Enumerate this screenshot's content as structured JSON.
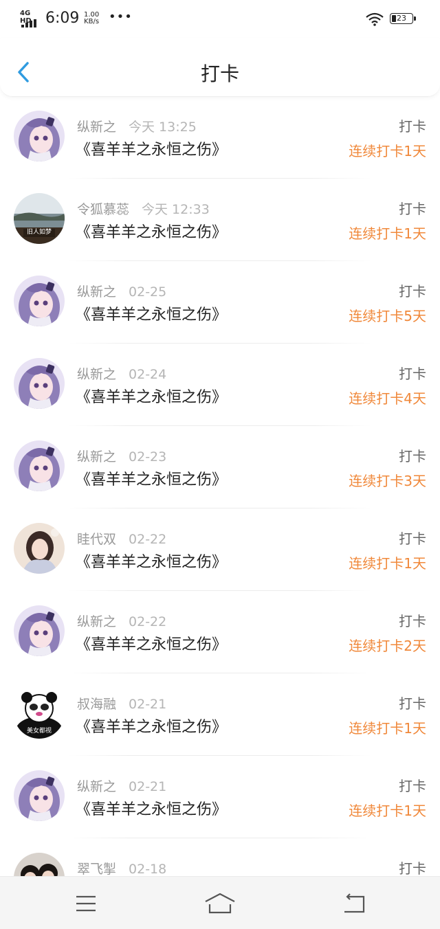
{
  "status_bar": {
    "network": "4G HD",
    "time": "6:09",
    "speed_value": "1.00",
    "speed_unit": "KB/s",
    "more": "•••",
    "battery": "23"
  },
  "header": {
    "title": "打卡"
  },
  "rows": [
    {
      "name": "纵新之",
      "date": "今天 13:25",
      "content": "《喜羊羊之永恒之伤》",
      "action": "打卡",
      "streak": "连续打卡1天",
      "avatar": "anime"
    },
    {
      "name": "令狐慕蕊",
      "date": "今天 12:33",
      "content": "《喜羊羊之永恒之伤》",
      "action": "打卡",
      "streak": "连续打卡1天",
      "avatar": "lake",
      "avatar_text": "旧人如梦"
    },
    {
      "name": "纵新之",
      "date": "02-25",
      "content": "《喜羊羊之永恒之伤》",
      "action": "打卡",
      "streak": "连续打卡5天",
      "avatar": "anime"
    },
    {
      "name": "纵新之",
      "date": "02-24",
      "content": "《喜羊羊之永恒之伤》",
      "action": "打卡",
      "streak": "连续打卡4天",
      "avatar": "anime"
    },
    {
      "name": "纵新之",
      "date": "02-23",
      "content": "《喜羊羊之永恒之伤》",
      "action": "打卡",
      "streak": "连续打卡3天",
      "avatar": "anime"
    },
    {
      "name": "眭代双",
      "date": "02-22",
      "content": "《喜羊羊之永恒之伤》",
      "action": "打卡",
      "streak": "连续打卡1天",
      "avatar": "girl"
    },
    {
      "name": "纵新之",
      "date": "02-22",
      "content": "《喜羊羊之永恒之伤》",
      "action": "打卡",
      "streak": "连续打卡2天",
      "avatar": "anime"
    },
    {
      "name": "叔海融",
      "date": "02-21",
      "content": "《喜羊羊之永恒之伤》",
      "action": "打卡",
      "streak": "连续打卡1天",
      "avatar": "panda",
      "avatar_text": "美女都视"
    },
    {
      "name": "纵新之",
      "date": "02-21",
      "content": "《喜羊羊之永恒之伤》",
      "action": "打卡",
      "streak": "连续打卡1天",
      "avatar": "anime"
    },
    {
      "name": "翠飞掣",
      "date": "02-18",
      "content": "",
      "action": "打卡",
      "streak": "",
      "avatar": "couple"
    }
  ],
  "colors": {
    "accent": "#2f9be0",
    "streak": "#f0883a"
  },
  "icons": {
    "back": "chevron-left-icon",
    "nav_menu": "menu-icon",
    "nav_home": "home-icon",
    "nav_back": "back-arrow-icon"
  }
}
